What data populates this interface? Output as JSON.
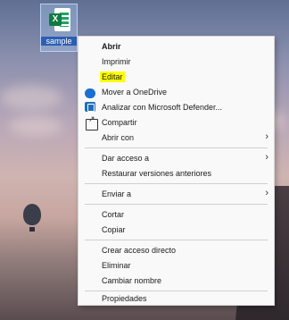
{
  "desktop": {
    "file_label": "sample",
    "file_badge": "X"
  },
  "menu": {
    "items": [
      {
        "label": "Abrir"
      },
      {
        "label": "Imprimir"
      },
      {
        "label": "Editar"
      },
      {
        "label": "Mover a OneDrive"
      },
      {
        "label": "Analizar con Microsoft Defender..."
      },
      {
        "label": "Compartir"
      },
      {
        "label": "Abrir con"
      },
      {
        "label": "Dar acceso a"
      },
      {
        "label": "Restaurar versiones anteriores"
      },
      {
        "label": "Enviar a"
      },
      {
        "label": "Cortar"
      },
      {
        "label": "Copiar"
      },
      {
        "label": "Crear acceso directo"
      },
      {
        "label": "Eliminar"
      },
      {
        "label": "Cambiar nombre"
      },
      {
        "label": "Propiedades"
      }
    ],
    "chevron": "›"
  },
  "colors": {
    "highlight": "#ffff00",
    "excel_green": "#107c41",
    "onedrive_blue": "#1b6fd1"
  }
}
